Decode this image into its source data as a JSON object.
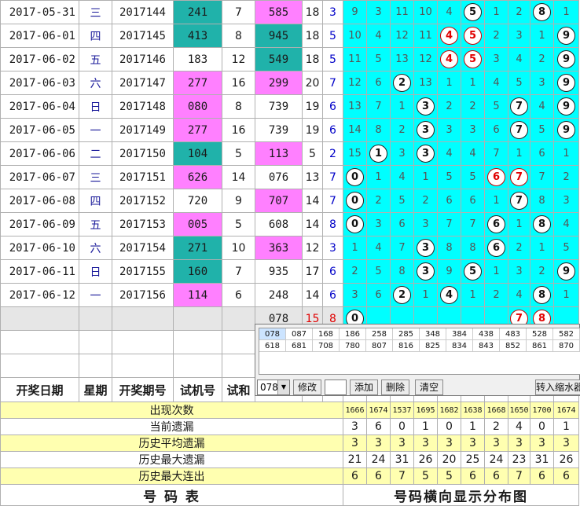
{
  "rows": [
    {
      "date": "2017-05-31",
      "week": "三",
      "issue": "2017144",
      "test": "241",
      "test_bg": "teal",
      "sum": "7",
      "draw": "585",
      "draw_bg": "pink",
      "a": "18",
      "b": "3",
      "dist": [
        {
          "v": "9"
        },
        {
          "v": "3"
        },
        {
          "v": "11"
        },
        {
          "v": "10"
        },
        {
          "v": "4"
        },
        {
          "v": "5",
          "ball": "k"
        },
        {
          "v": "1"
        },
        {
          "v": "2"
        },
        {
          "v": "8",
          "ball": "k"
        },
        {
          "v": "1"
        }
      ]
    },
    {
      "date": "2017-06-01",
      "week": "四",
      "issue": "2017145",
      "test": "413",
      "test_bg": "teal",
      "sum": "8",
      "draw": "945",
      "draw_bg": "teal",
      "a": "18",
      "b": "5",
      "dist": [
        {
          "v": "10"
        },
        {
          "v": "4"
        },
        {
          "v": "12"
        },
        {
          "v": "11"
        },
        {
          "v": "4",
          "ball": "r"
        },
        {
          "v": "5",
          "ball": "r"
        },
        {
          "v": "2"
        },
        {
          "v": "3"
        },
        {
          "v": "1"
        },
        {
          "v": "9",
          "ball": "k"
        }
      ]
    },
    {
      "date": "2017-06-02",
      "week": "五",
      "issue": "2017146",
      "test": "183",
      "test_bg": "",
      "sum": "12",
      "draw": "549",
      "draw_bg": "teal",
      "a": "18",
      "b": "5",
      "dist": [
        {
          "v": "11"
        },
        {
          "v": "5"
        },
        {
          "v": "13"
        },
        {
          "v": "12"
        },
        {
          "v": "4",
          "ball": "r"
        },
        {
          "v": "5",
          "ball": "r"
        },
        {
          "v": "3"
        },
        {
          "v": "4"
        },
        {
          "v": "2"
        },
        {
          "v": "9",
          "ball": "k"
        }
      ]
    },
    {
      "date": "2017-06-03",
      "week": "六",
      "issue": "2017147",
      "test": "277",
      "test_bg": "pink",
      "sum": "16",
      "draw": "299",
      "draw_bg": "pink",
      "a": "20",
      "b": "7",
      "dist": [
        {
          "v": "12"
        },
        {
          "v": "6"
        },
        {
          "v": "2",
          "ball": "k"
        },
        {
          "v": "13"
        },
        {
          "v": "1"
        },
        {
          "v": "1"
        },
        {
          "v": "4"
        },
        {
          "v": "5"
        },
        {
          "v": "3"
        },
        {
          "v": "9",
          "ball": "k"
        }
      ]
    },
    {
      "date": "2017-06-04",
      "week": "日",
      "issue": "2017148",
      "test": "080",
      "test_bg": "pink",
      "sum": "8",
      "draw": "739",
      "draw_bg": "",
      "a": "19",
      "b": "6",
      "dist": [
        {
          "v": "13"
        },
        {
          "v": "7"
        },
        {
          "v": "1"
        },
        {
          "v": "3",
          "ball": "k"
        },
        {
          "v": "2"
        },
        {
          "v": "2"
        },
        {
          "v": "5"
        },
        {
          "v": "7",
          "ball": "k"
        },
        {
          "v": "4"
        },
        {
          "v": "9",
          "ball": "k"
        }
      ]
    },
    {
      "date": "2017-06-05",
      "week": "一",
      "issue": "2017149",
      "test": "277",
      "test_bg": "pink",
      "sum": "16",
      "draw": "739",
      "draw_bg": "",
      "a": "19",
      "b": "6",
      "dist": [
        {
          "v": "14"
        },
        {
          "v": "8"
        },
        {
          "v": "2"
        },
        {
          "v": "3",
          "ball": "k"
        },
        {
          "v": "3"
        },
        {
          "v": "3"
        },
        {
          "v": "6"
        },
        {
          "v": "7",
          "ball": "k"
        },
        {
          "v": "5"
        },
        {
          "v": "9",
          "ball": "k"
        }
      ]
    },
    {
      "date": "2017-06-06",
      "week": "二",
      "issue": "2017150",
      "test": "104",
      "test_bg": "teal",
      "sum": "5",
      "draw": "113",
      "draw_bg": "pink",
      "a": "5",
      "b": "2",
      "dist": [
        {
          "v": "15"
        },
        {
          "v": "1",
          "ball": "k"
        },
        {
          "v": "3"
        },
        {
          "v": "3",
          "ball": "k"
        },
        {
          "v": "4"
        },
        {
          "v": "4"
        },
        {
          "v": "7"
        },
        {
          "v": "1"
        },
        {
          "v": "6"
        },
        {
          "v": "1"
        }
      ]
    },
    {
      "date": "2017-06-07",
      "week": "三",
      "issue": "2017151",
      "test": "626",
      "test_bg": "pink",
      "sum": "14",
      "draw": "076",
      "draw_bg": "",
      "a": "13",
      "b": "7",
      "dist": [
        {
          "v": "0",
          "ball": "k"
        },
        {
          "v": "1"
        },
        {
          "v": "4"
        },
        {
          "v": "1"
        },
        {
          "v": "5"
        },
        {
          "v": "5"
        },
        {
          "v": "6",
          "ball": "r"
        },
        {
          "v": "7",
          "ball": "r"
        },
        {
          "v": "7"
        },
        {
          "v": "2"
        }
      ]
    },
    {
      "date": "2017-06-08",
      "week": "四",
      "issue": "2017152",
      "test": "720",
      "test_bg": "",
      "sum": "9",
      "draw": "707",
      "draw_bg": "pink",
      "a": "14",
      "b": "7",
      "dist": [
        {
          "v": "0",
          "ball": "k"
        },
        {
          "v": "2"
        },
        {
          "v": "5"
        },
        {
          "v": "2"
        },
        {
          "v": "6"
        },
        {
          "v": "6"
        },
        {
          "v": "1"
        },
        {
          "v": "7",
          "ball": "k"
        },
        {
          "v": "8"
        },
        {
          "v": "3"
        }
      ]
    },
    {
      "date": "2017-06-09",
      "week": "五",
      "issue": "2017153",
      "test": "005",
      "test_bg": "pink",
      "sum": "5",
      "draw": "608",
      "draw_bg": "",
      "a": "14",
      "b": "8",
      "dist": [
        {
          "v": "0",
          "ball": "k"
        },
        {
          "v": "3"
        },
        {
          "v": "6"
        },
        {
          "v": "3"
        },
        {
          "v": "7"
        },
        {
          "v": "7"
        },
        {
          "v": "6",
          "ball": "k"
        },
        {
          "v": "1"
        },
        {
          "v": "8",
          "ball": "k"
        },
        {
          "v": "4"
        }
      ]
    },
    {
      "date": "2017-06-10",
      "week": "六",
      "issue": "2017154",
      "test": "271",
      "test_bg": "teal",
      "sum": "10",
      "draw": "363",
      "draw_bg": "pink",
      "a": "12",
      "b": "3",
      "dist": [
        {
          "v": "1"
        },
        {
          "v": "4"
        },
        {
          "v": "7"
        },
        {
          "v": "3",
          "ball": "k"
        },
        {
          "v": "8"
        },
        {
          "v": "8"
        },
        {
          "v": "6",
          "ball": "k"
        },
        {
          "v": "2"
        },
        {
          "v": "1"
        },
        {
          "v": "5"
        }
      ]
    },
    {
      "date": "2017-06-11",
      "week": "日",
      "issue": "2017155",
      "test": "160",
      "test_bg": "teal",
      "sum": "7",
      "draw": "935",
      "draw_bg": "",
      "a": "17",
      "b": "6",
      "dist": [
        {
          "v": "2"
        },
        {
          "v": "5"
        },
        {
          "v": "8"
        },
        {
          "v": "3",
          "ball": "k"
        },
        {
          "v": "9"
        },
        {
          "v": "5",
          "ball": "k"
        },
        {
          "v": "1"
        },
        {
          "v": "3"
        },
        {
          "v": "2"
        },
        {
          "v": "9",
          "ball": "k"
        }
      ]
    },
    {
      "date": "2017-06-12",
      "week": "一",
      "issue": "2017156",
      "test": "114",
      "test_bg": "pink",
      "sum": "6",
      "draw": "248",
      "draw_bg": "",
      "a": "14",
      "b": "6",
      "dist": [
        {
          "v": "3"
        },
        {
          "v": "6"
        },
        {
          "v": "2",
          "ball": "k"
        },
        {
          "v": "1"
        },
        {
          "v": "4",
          "ball": "k"
        },
        {
          "v": "1"
        },
        {
          "v": "2"
        },
        {
          "v": "4"
        },
        {
          "v": "8",
          "ball": "k"
        },
        {
          "v": "1"
        }
      ]
    }
  ],
  "pending": {
    "draw": "078",
    "a": "15",
    "b": "8",
    "dist": [
      {
        "v": "0",
        "ball": "k"
      },
      {
        "v": ""
      },
      {
        "v": ""
      },
      {
        "v": ""
      },
      {
        "v": ""
      },
      {
        "v": ""
      },
      {
        "v": ""
      },
      {
        "v": "7",
        "ball": "r"
      },
      {
        "v": "8",
        "ball": "r"
      },
      {
        "v": ""
      }
    ]
  },
  "headers": {
    "date": "开奖日期",
    "week": "星期",
    "issue": "开奖期号",
    "test": "试机号",
    "sum": "试和"
  },
  "stats": [
    {
      "label": "出现次数",
      "style": "y",
      "small": true,
      "values": [
        "1666",
        "1674",
        "1537",
        "1695",
        "1682",
        "1638",
        "1668",
        "1650",
        "1700",
        "1674"
      ]
    },
    {
      "label": "当前遗漏",
      "style": "w",
      "values": [
        "3",
        "6",
        "0",
        "1",
        "0",
        "1",
        "2",
        "4",
        "0",
        "1"
      ],
      "colors": [
        "blue",
        "blue",
        "red",
        "blue",
        "red",
        "red",
        "blue",
        "green",
        "blue",
        "red"
      ]
    },
    {
      "label": "历史平均遗漏",
      "style": "y",
      "values": [
        "3",
        "3",
        "3",
        "3",
        "3",
        "3",
        "3",
        "3",
        "3",
        "3"
      ],
      "colors": [
        "red",
        "red",
        "red",
        "blue",
        "blue",
        "blue",
        "red",
        "blue",
        "blue",
        "red"
      ]
    },
    {
      "label": "历史最大遗漏",
      "style": "w",
      "values": [
        "21",
        "24",
        "31",
        "26",
        "20",
        "25",
        "24",
        "23",
        "31",
        "26"
      ]
    },
    {
      "label": "历史最大连出",
      "style": "y",
      "values": [
        "6",
        "6",
        "7",
        "5",
        "5",
        "6",
        "6",
        "7",
        "6",
        "6"
      ]
    }
  ],
  "footer": {
    "left": "号  码  表",
    "right": "号码横向显示分布图"
  },
  "panel": {
    "codes_row1": [
      "078",
      "087",
      "168",
      "186",
      "258",
      "285",
      "348",
      "384",
      "438",
      "483",
      "528",
      "582"
    ],
    "codes_row2": [
      "618",
      "681",
      "708",
      "780",
      "807",
      "816",
      "825",
      "834",
      "843",
      "852",
      "861",
      "870"
    ],
    "combo_value": "078",
    "combo_arrow": "▼",
    "btn_modify": "修改",
    "btn_add": "添加",
    "btn_delete": "删除",
    "btn_clear": "清空",
    "btn_transfer": "转入缩水器"
  }
}
